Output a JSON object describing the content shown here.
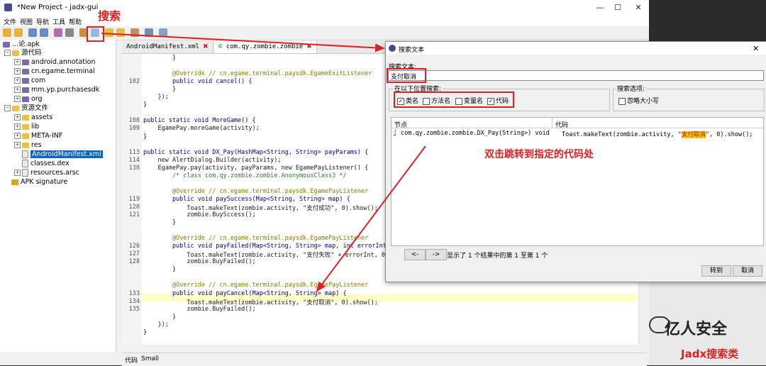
{
  "window": {
    "title": "*New Project - jadx-gui",
    "minimize": "—",
    "maximize": "☐",
    "close": "✕"
  },
  "menu": [
    "文件",
    "视图",
    "导航",
    "工具",
    "帮助"
  ],
  "annotations": {
    "search_label": "搜索",
    "jump_label": "双击跳转到指定的代码处"
  },
  "tree": {
    "root": "...论.apk",
    "source": "源代码",
    "packages": [
      "android.annotation",
      "cn.egame.terminal",
      "com",
      "mm.yp.purchasesdk",
      "org"
    ],
    "resources": "资源文件",
    "res_items": [
      "assets",
      "lib",
      "META-INF",
      "res"
    ],
    "files": [
      "AndroidManifest.xml",
      "classes.dex",
      "resources.arsc"
    ],
    "signature": "APK signature"
  },
  "tabs": [
    {
      "label": "AndroidManifest.xml",
      "close": "✖"
    },
    {
      "label": "com.qy.zombie.zombie",
      "close": "✖"
    }
  ],
  "code_lines": [
    {
      "n": "",
      "t": "        }"
    },
    {
      "n": "",
      "t": ""
    },
    {
      "n": "",
      "t": "        @Override // cn.egame.terminal.paysdk.EgameExitListener"
    },
    {
      "n": "102",
      "t": "        public void cancel() {"
    },
    {
      "n": "",
      "t": "        }"
    },
    {
      "n": "",
      "t": "    });"
    },
    {
      "n": "",
      "t": "}"
    },
    {
      "n": "",
      "t": ""
    },
    {
      "n": "108",
      "t": "public static void MoreGame() {"
    },
    {
      "n": "109",
      "t": "    EgamePay.moreGame(activity);"
    },
    {
      "n": "",
      "t": "}"
    },
    {
      "n": "",
      "t": ""
    },
    {
      "n": "113",
      "t": "public static void DX_Pay(HashMap<String, String> payParams) {"
    },
    {
      "n": "114",
      "t": "    new AlertDialog.Builder(activity);"
    },
    {
      "n": "138",
      "t": "    EgamePay.pay(activity, payParams, new EgamePayListener() {"
    },
    {
      "n": "",
      "t": "        /* class com.qy.zombie.zombie.AnonymousClass3 */"
    },
    {
      "n": "",
      "t": ""
    },
    {
      "n": "",
      "t": "        @Override // cn.egame.terminal.paysdk.EgamePayListener"
    },
    {
      "n": "119",
      "t": "        public void paySuccess(Map<String, String> map) {"
    },
    {
      "n": "120",
      "t": "            Toast.makeText(zombie.activity, \"支付成功\", 0).show();"
    },
    {
      "n": "121",
      "t": "            zombie.BuySccess();"
    },
    {
      "n": "",
      "t": "        }"
    },
    {
      "n": "",
      "t": ""
    },
    {
      "n": "",
      "t": "        @Override // cn.egame.terminal.paysdk.EgamePayListener"
    },
    {
      "n": "126",
      "t": "        public void payFailed(Map<String, String> map, int errorInt"
    },
    {
      "n": "127",
      "t": "            Toast.makeText(zombie.activity, \"支付失败\" + errorInt, 0"
    },
    {
      "n": "128",
      "t": "            zombie.BuyFailed();"
    },
    {
      "n": "",
      "t": "        }"
    },
    {
      "n": "",
      "t": ""
    },
    {
      "n": "",
      "t": "        @Override // cn.egame.terminal.paysdk.EgamePayListener"
    },
    {
      "n": "133",
      "t": "        public void payCancel(Map<String, String> map) {"
    },
    {
      "n": "134",
      "t": "            Toast.makeText(zombie.activity, \"支付取消\", 0).show();"
    },
    {
      "n": "135",
      "t": "            zombie.BuyFailed();"
    },
    {
      "n": "",
      "t": "        }"
    },
    {
      "n": "",
      "t": "    });"
    },
    {
      "n": "",
      "t": "}"
    }
  ],
  "bottom_tabs": [
    "代码",
    "Smali"
  ],
  "dialog": {
    "title": "搜索文本",
    "search_label": "搜索文本:",
    "search_value": "支付取消",
    "location_label": "在以下位置搜索:",
    "options_label": "搜索选项:",
    "checkboxes": [
      {
        "label": "类名",
        "checked": true
      },
      {
        "label": "方法名",
        "checked": false
      },
      {
        "label": "变量名",
        "checked": false
      },
      {
        "label": "代码",
        "checked": true
      }
    ],
    "ignore_case": "忽略大小写",
    "col_node": "节点",
    "col_code": "代码",
    "result_node": "com.qy.zombie.zombie.DX_Pay(String>) void",
    "result_code_prefix": "Toast.makeText(zombie.activity, \"",
    "result_code_match": "支付取消",
    "result_code_suffix": "\", 0).show();",
    "prev": "<-",
    "next": "->",
    "status": "显示了 1 个结果中的第 1 至第 1 个",
    "goto": "转到",
    "cancel": "取消"
  },
  "watermark": {
    "brand": "亿人安全",
    "subtitle": "Jadx搜索类"
  },
  "colors": {
    "annotation": "#e02020",
    "highlight": "#ffffc8",
    "match": "#ffcc00"
  }
}
